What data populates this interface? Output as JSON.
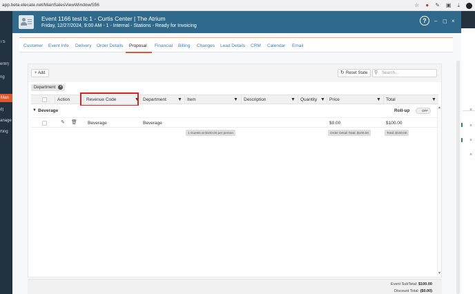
{
  "browser": {
    "url": "app.beta.elecate.net/MainSalesViewWindow/556",
    "icons": [
      "star-icon",
      "extension-shield-icon",
      "pen-icon",
      "puzzle-icon",
      "download-icon",
      "profile-icon"
    ]
  },
  "background_app": {
    "left_texts": [
      "TS",
      "erBI)",
      "ng",
      "Man",
      "d)",
      "anage",
      "rting"
    ],
    "left_highlight_color": "#e0572b"
  },
  "window": {
    "title": "Event 1166 test lc 1 - Curtis Center | The Atrium",
    "subtitle": "Friday, 12/27/2024, 9:00 AM - 1 - Internal - Stations - Ready for Invoicing",
    "help_label": "?",
    "minimize_label": "–",
    "restore_label": "◻",
    "close_label": "×",
    "header_color": "#2f6a8d"
  },
  "tabs": [
    {
      "label": "Customer",
      "active": false
    },
    {
      "label": "Event Info",
      "active": false
    },
    {
      "label": "Delivery",
      "active": false
    },
    {
      "label": "Order Details",
      "active": false
    },
    {
      "label": "Proposal",
      "active": true
    },
    {
      "label": "Financial",
      "active": false
    },
    {
      "label": "Billing",
      "active": false
    },
    {
      "label": "Changes",
      "active": false
    },
    {
      "label": "Lead Details",
      "active": false
    },
    {
      "label": "CRM",
      "active": false
    },
    {
      "label": "Calendar",
      "active": false
    },
    {
      "label": "Email",
      "active": false
    }
  ],
  "toolbar": {
    "add_label": "+ Add",
    "reset_label": "Reset State",
    "search_placeholder": "Search..."
  },
  "group_by": {
    "chip_label": "Department",
    "remove_label": "×"
  },
  "grid": {
    "columns": [
      "Action",
      "Revenue Code",
      "Department",
      "Item",
      "Description",
      "Quantity",
      "Price",
      "Total"
    ],
    "highlighted_column": "Revenue Code",
    "highlight_color": "#e01f1f",
    "group": {
      "name": "Beverage",
      "rollup_label": "Roll-up",
      "rollup_toggle": "OFF"
    },
    "rows": [
      {
        "revenue_code": "Beverage",
        "department": "Beverage",
        "item": "",
        "description": "",
        "quantity": "",
        "price": "$0.00",
        "total": "$100.00"
      }
    ],
    "summary": {
      "guests": "1 Guests at $100.00 per person",
      "order_detail_total": "Order Detail Total: $100.00",
      "total": "Total: $100.00"
    }
  },
  "footer": {
    "subtotal_label": "Event SubTotal:",
    "subtotal_value": "$100.00",
    "discount_label": "Discount Total:",
    "discount_value": "($0.00)"
  }
}
